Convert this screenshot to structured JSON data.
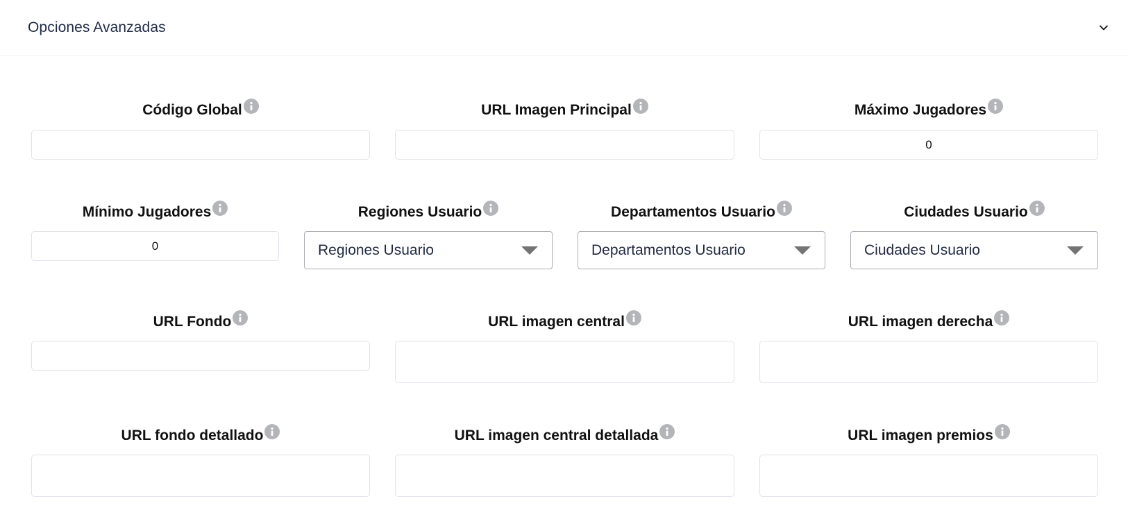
{
  "panel": {
    "title": "Opciones Avanzadas"
  },
  "fields": {
    "codigo_global": {
      "label": "Código Global",
      "value": ""
    },
    "url_imagen_principal": {
      "label": "URL Imagen Principal",
      "value": ""
    },
    "maximo_jugadores": {
      "label": "Máximo Jugadores",
      "value": "0"
    },
    "minimo_jugadores": {
      "label": "Mínimo Jugadores",
      "value": "0"
    },
    "regiones_usuario": {
      "label": "Regiones Usuario",
      "placeholder": "Regiones Usuario"
    },
    "departamentos_usuario": {
      "label": "Departamentos Usuario",
      "placeholder": "Departamentos Usuario"
    },
    "ciudades_usuario": {
      "label": "Ciudades Usuario",
      "placeholder": "Ciudades Usuario"
    },
    "url_fondo": {
      "label": "URL Fondo",
      "value": ""
    },
    "url_imagen_central": {
      "label": "URL imagen central",
      "value": ""
    },
    "url_imagen_derecha": {
      "label": "URL imagen derecha",
      "value": ""
    },
    "url_fondo_detallado": {
      "label": "URL fondo detallado",
      "value": ""
    },
    "url_imagen_central_detallada": {
      "label": "URL imagen central detallada",
      "value": ""
    },
    "url_imagen_premios": {
      "label": "URL imagen premios",
      "value": ""
    }
  },
  "icons": {
    "info": "info-icon",
    "collapse": "chevron-down-icon"
  },
  "colors": {
    "title": "#1d2b4a",
    "info_icon": "#b3b5b9",
    "input_border": "#dfe3ea",
    "select_border": "#a9adb3",
    "caret": "#747474"
  }
}
